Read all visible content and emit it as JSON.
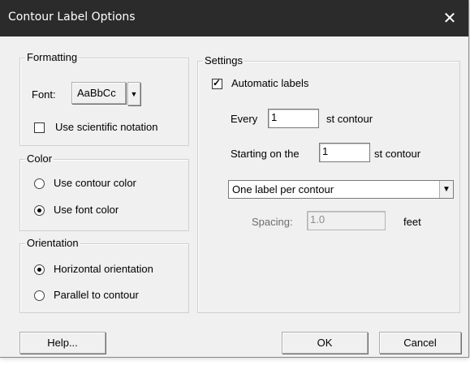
{
  "window": {
    "title": "Contour Label Options",
    "close_glyph": "✕"
  },
  "formatting": {
    "title": "Formatting",
    "font_label": "Font:",
    "font_button": "AaBbCc",
    "dropdown_glyph": "▼",
    "sci_notation_label": "Use scientific notation",
    "sci_notation_checked": false
  },
  "color": {
    "title": "Color",
    "options": [
      "Use contour color",
      "Use font color"
    ],
    "selected": 1
  },
  "orientation": {
    "title": "Orientation",
    "options": [
      "Horizontal orientation",
      "Parallel to contour"
    ],
    "selected": 0
  },
  "settings": {
    "title": "Settings",
    "automatic_label": "Automatic labels",
    "automatic_checked": true,
    "check_glyph": "✓",
    "every_label": "Every",
    "every_value": "1",
    "every_suffix": "st contour",
    "starting_label": "Starting on the",
    "starting_value": "1",
    "starting_suffix": "st contour",
    "mode_value": "One label per contour",
    "spacing_label": "Spacing:",
    "spacing_value": "1.0",
    "spacing_unit": "feet"
  },
  "buttons": {
    "help": "Help...",
    "ok": "OK",
    "cancel": "Cancel"
  }
}
